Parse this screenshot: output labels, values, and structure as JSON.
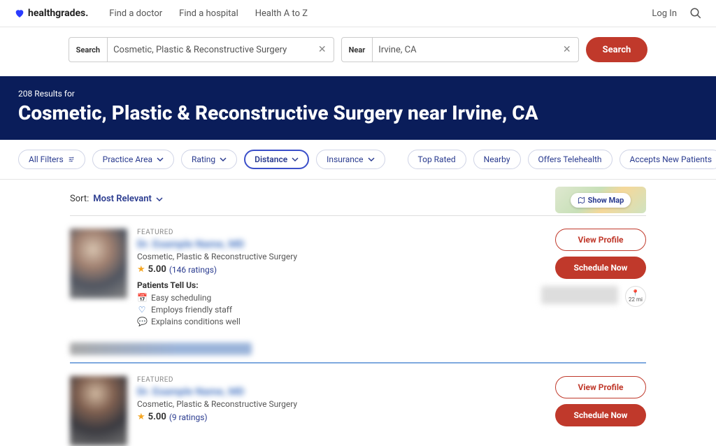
{
  "brand": "healthgrades",
  "nav": {
    "find_doctor": "Find a doctor",
    "find_hospital": "Find a hospital",
    "health_az": "Health A to Z",
    "login": "Log In"
  },
  "search": {
    "label_search": "Search",
    "value_search": "Cosmetic, Plastic & Reconstructive Surgery",
    "label_near": "Near",
    "value_near": "Irvine, CA",
    "button": "Search"
  },
  "hero": {
    "sub": "208 Results for",
    "title": "Cosmetic, Plastic & Reconstructive Surgery near Irvine, CA"
  },
  "filters": {
    "all": "All Filters",
    "practice_area": "Practice Area",
    "rating": "Rating",
    "distance": "Distance",
    "insurance": "Insurance",
    "top_rated": "Top Rated",
    "nearby": "Nearby",
    "telehealth": "Offers Telehealth",
    "new_patients": "Accepts New Patients"
  },
  "sort": {
    "label": "Sort:",
    "value": "Most Relevant"
  },
  "map": {
    "button": "Show Map"
  },
  "card": {
    "featured": "FEATURED",
    "name_placeholder": "Dr. Example Name, MD",
    "specialty": "Cosmetic, Plastic & Reconstructive Surgery",
    "rating": "5.00",
    "rating_count": "(146 ratings)",
    "rating_count2": "(9 ratings)",
    "tellus": "Patients Tell Us:",
    "b1": "Easy scheduling",
    "b2": "Employs friendly staff",
    "b3": "Explains conditions well",
    "view": "View Profile",
    "schedule": "Schedule Now",
    "distance": "22 mi"
  }
}
